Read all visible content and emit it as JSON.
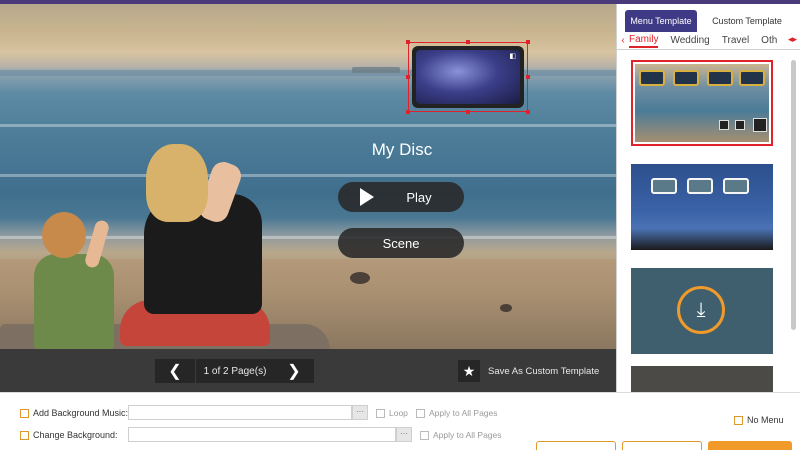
{
  "preview": {
    "menu_title": "My Disc",
    "play_label": "Play",
    "scene_label": "Scene"
  },
  "pager": {
    "page_text": "1 of 2 Page(s)",
    "prev_icon": "chevron-left-icon",
    "next_icon": "chevron-right-icon",
    "save_label": "Save As Custom Template",
    "save_icon": "star-icon"
  },
  "right_panel": {
    "tabs": [
      "Menu Template",
      "Custom Template"
    ],
    "categories": [
      "Family",
      "Wedding",
      "Travel",
      "Oth"
    ],
    "active_category": "Family"
  },
  "settings": {
    "bg_music_label": "Add Background Music:",
    "loop_label": "Loop",
    "apply_all_label": "Apply to All Pages",
    "change_bg_label": "Change Background:",
    "no_menu_label": "No Menu"
  },
  "colors": {
    "accent": "#e0222a",
    "tab_active": "#3f3a86",
    "checkbox_border": "#e0982a",
    "pager_bar": "#3a3a3a"
  }
}
